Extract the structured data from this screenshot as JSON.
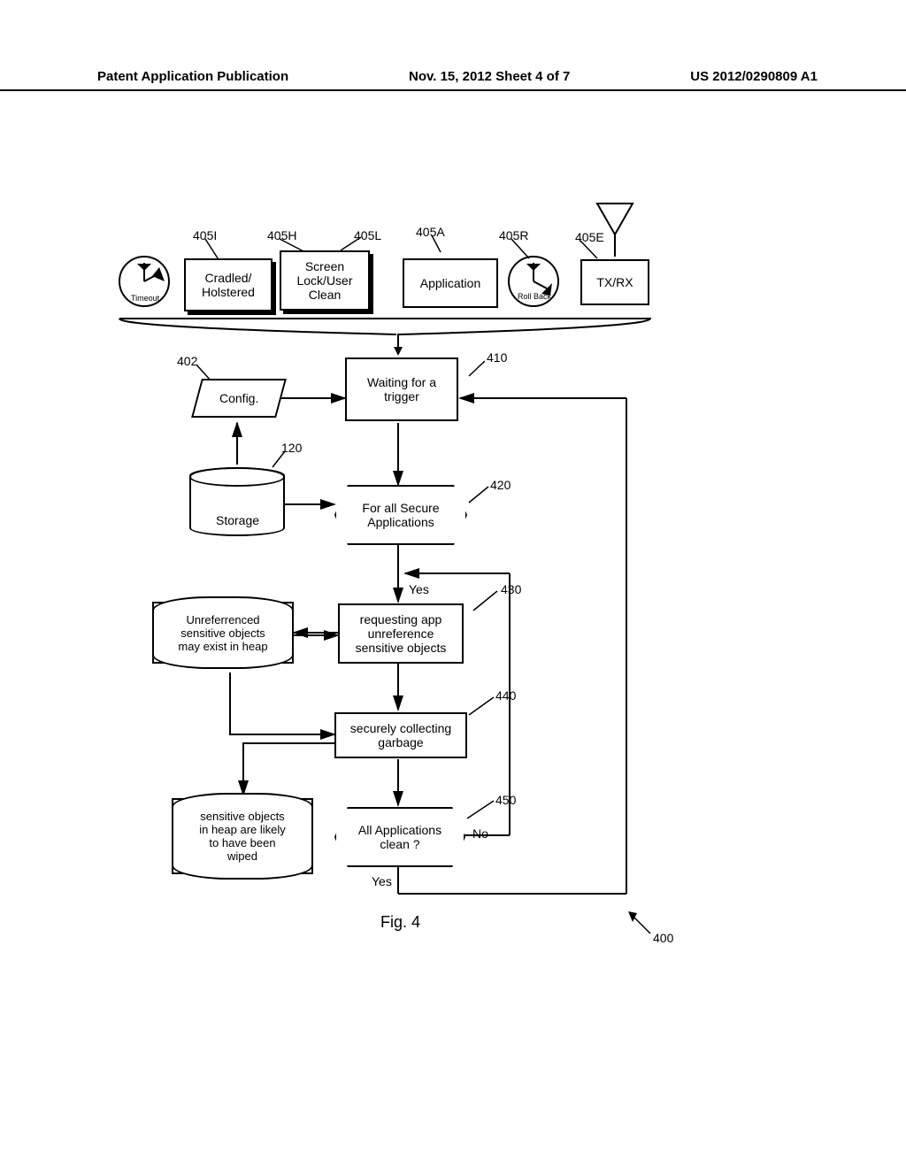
{
  "header": {
    "left": "Patent Application Publication",
    "center": "Nov. 15, 2012  Sheet 4 of 7",
    "right": "US 2012/0290809 A1"
  },
  "labels": {
    "ref_405I": "405I",
    "ref_405H": "405H",
    "ref_405L": "405L",
    "ref_405A": "405A",
    "ref_405R": "405R",
    "ref_405E": "405E",
    "ref_402": "402",
    "ref_120": "120",
    "ref_410": "410",
    "ref_420": "420",
    "ref_430": "430",
    "ref_440": "440",
    "ref_450": "450",
    "ref_400": "400",
    "timeout": "Timeout",
    "rollback": "Roll Back",
    "txrx": "TX/RX",
    "yes1": "Yes",
    "yes2": "Yes",
    "no": "No",
    "fig": "Fig. 4"
  },
  "boxes": {
    "cradled": "Cradled/\nHolstered",
    "screen": "Screen\nLock/User\nClean",
    "application": "Application",
    "waiting": "Waiting for a\ntrigger",
    "config": "Config.",
    "storage": "Storage",
    "secure_apps": "For all Secure\nApplications",
    "request_unref": "requesting  app\nunreference\nsensitive objects",
    "collect": "securely collecting\ngarbage",
    "all_clean": "All Applications\nclean ?",
    "cloud_unref": "Unreferrenced\nsensitive objects\nmay exist in heap",
    "cloud_wiped": "sensitive objects\nin heap are likely\nto have been\nwiped"
  }
}
